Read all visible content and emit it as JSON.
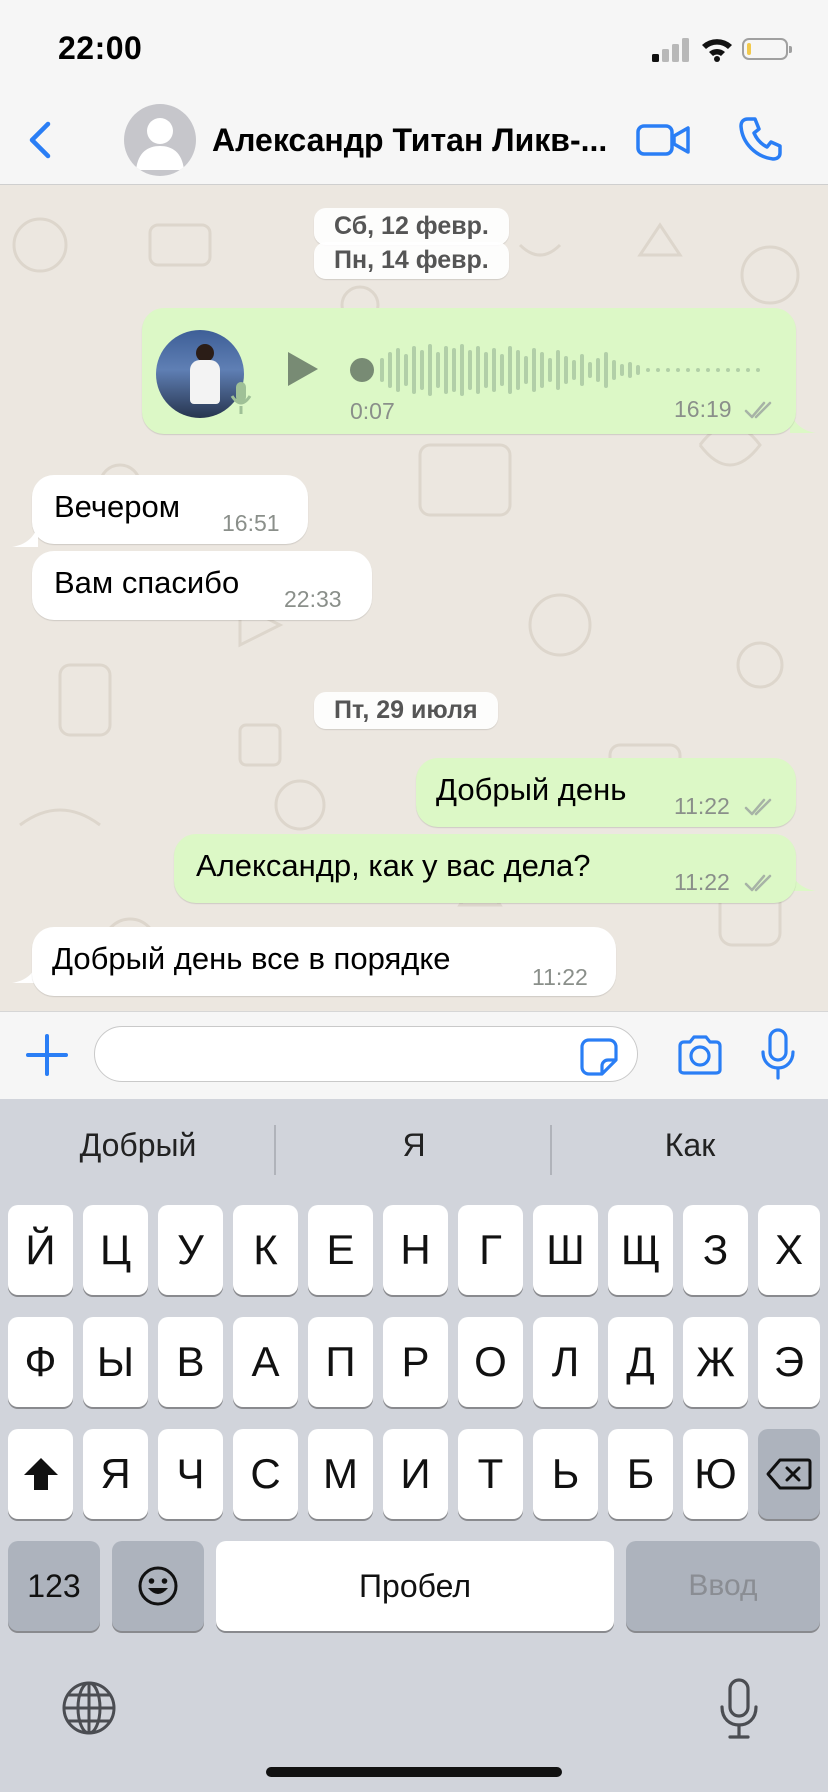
{
  "status_bar": {
    "time": "22:00"
  },
  "header": {
    "contact_name": "Александр Титан Ликв-..."
  },
  "chat": {
    "date_1": "Сб, 12 февр.",
    "date_2": "Пн, 14 февр.",
    "voice": {
      "duration": "0:07",
      "time": "16:19"
    },
    "messages": [
      {
        "direction": "in",
        "text": "Вечером",
        "time": "16:51"
      },
      {
        "direction": "in",
        "text": "Вам спасибо",
        "time": "22:33"
      },
      {
        "direction": "out",
        "text": "Добрый день",
        "time": "11:22"
      },
      {
        "direction": "out",
        "text": "Александр, как у вас дела?",
        "time": "11:22"
      },
      {
        "direction": "in",
        "text": "Добрый день все в порядке",
        "time": "11:22"
      }
    ],
    "date_3": "Пт, 29 июля"
  },
  "input": {
    "placeholder": ""
  },
  "keyboard": {
    "suggestions": [
      "Добрый",
      "Я",
      "Как"
    ],
    "row1": [
      "Й",
      "Ц",
      "У",
      "К",
      "Е",
      "Н",
      "Г",
      "Ш",
      "Щ",
      "З",
      "Х"
    ],
    "row2": [
      "Ф",
      "Ы",
      "В",
      "А",
      "П",
      "Р",
      "О",
      "Л",
      "Д",
      "Ж",
      "Э"
    ],
    "row3": [
      "Я",
      "Ч",
      "С",
      "М",
      "И",
      "Т",
      "Ь",
      "Б",
      "Ю"
    ],
    "numbers_label": "123",
    "space_label": "Пробел",
    "enter_label": "Ввод"
  },
  "colors": {
    "accent": "#2a7ef5",
    "outgoing_bubble": "#dcf8c6",
    "incoming_bubble": "#ffffff"
  },
  "icons": [
    "back-icon",
    "video-call-icon",
    "phone-icon",
    "play-icon",
    "plus-icon",
    "sticker-icon",
    "camera-icon",
    "microphone-icon",
    "globe-icon",
    "shift-icon",
    "backspace-icon",
    "emoji-icon"
  ]
}
